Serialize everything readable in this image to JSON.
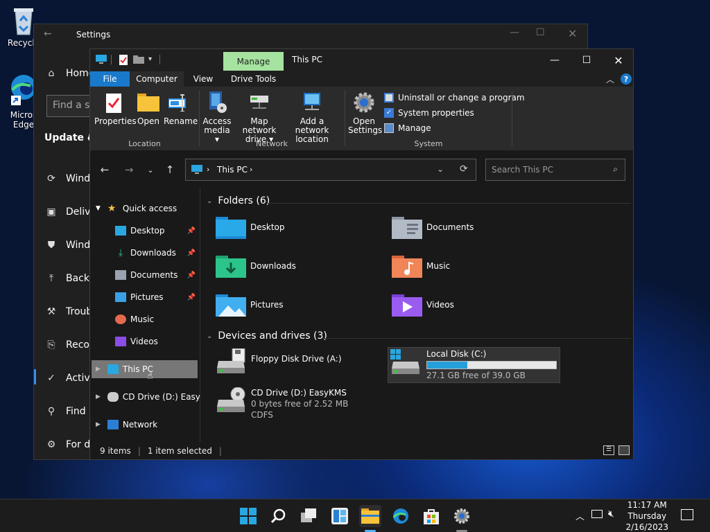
{
  "desktop": {
    "recycle_label": "Recycle",
    "edge_label_1": "Micros",
    "edge_label_2": "Edge"
  },
  "settings": {
    "title": "Settings",
    "nav_home": "Home",
    "search_placeholder": "Find a se",
    "section": "Update & S",
    "items": [
      "Windo",
      "Delive",
      "Windo",
      "Backu",
      "Troub",
      "Recov",
      "Activa",
      "Find r",
      "For de"
    ]
  },
  "explorer": {
    "window_title": "This PC",
    "manage_tab": "Manage",
    "tabs": {
      "file": "File",
      "computer": "Computer",
      "view": "View",
      "drive_tools": "Drive Tools"
    },
    "ribbon": {
      "location": {
        "label": "Location",
        "properties": "Properties",
        "open": "Open",
        "rename": "Rename"
      },
      "network": {
        "label": "Network",
        "access_media_1": "Access",
        "access_media_2": "media ▾",
        "map_drive_1": "Map network",
        "map_drive_2": "drive ▾",
        "add_location_1": "Add a network",
        "add_location_2": "location"
      },
      "system": {
        "label": "System",
        "open_settings_1": "Open",
        "open_settings_2": "Settings",
        "uninstall": "Uninstall or change a program",
        "system_properties": "System properties",
        "manage": "Manage"
      }
    },
    "address": {
      "path": "This PC",
      "search_placeholder": "Search This PC"
    },
    "nav": {
      "quick_access": "Quick access",
      "items": [
        {
          "label": "Desktop",
          "pinned": true
        },
        {
          "label": "Downloads",
          "pinned": true
        },
        {
          "label": "Documents",
          "pinned": true
        },
        {
          "label": "Pictures",
          "pinned": true
        },
        {
          "label": "Music",
          "pinned": false
        },
        {
          "label": "Videos",
          "pinned": false
        }
      ],
      "this_pc": "This PC",
      "cd_drive": "CD Drive (D:) EasyKM",
      "network": "Network"
    },
    "folders": {
      "heading": "Folders (6)",
      "items": [
        "Desktop",
        "Documents",
        "Downloads",
        "Music",
        "Pictures",
        "Videos"
      ]
    },
    "devices": {
      "heading": "Devices and drives (3)",
      "floppy": {
        "name": "Floppy Disk Drive (A:)"
      },
      "local_disk": {
        "name": "Local Disk (C:)",
        "free": "27.1 GB free of 39.0 GB",
        "used_fraction": 0.31
      },
      "cd": {
        "name": "CD Drive (D:) EasyKMS",
        "free": "0 bytes free of 2.52 MB",
        "fs": "CDFS"
      }
    },
    "status": {
      "items": "9 items",
      "selected": "1 item selected"
    }
  },
  "taskbar": {
    "time": "11:17 AM",
    "day": "Thursday",
    "date": "2/16/2023"
  },
  "colors": {
    "manage_tab": "#a6e3a0",
    "file_tab": "#1979ca",
    "accent": "#3c8ce7",
    "drive_bar": "#26a0da"
  }
}
